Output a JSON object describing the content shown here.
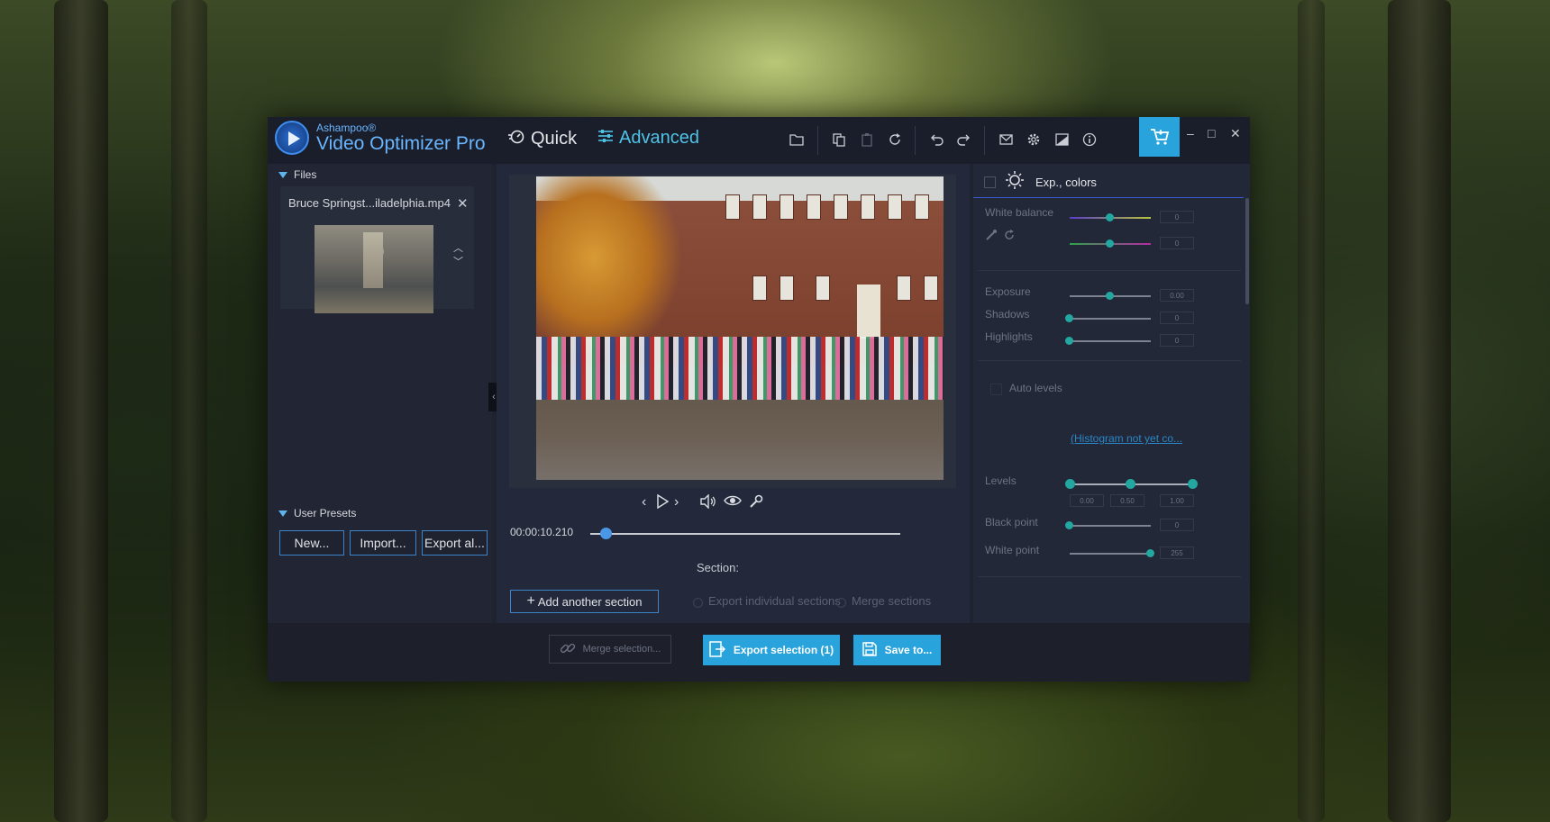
{
  "app": {
    "brand_small": "Ashampoo®",
    "brand_big": "Video Optimizer Pro",
    "mode_quick": "Quick",
    "mode_advanced": "Advanced",
    "accent_color": "#29a3dc",
    "toolbar_icons": [
      "folder-icon",
      "copy-icon",
      "paste-icon",
      "rotate-icon",
      "undo-icon",
      "redo-icon",
      "mail-icon",
      "settings-icon",
      "edit-icon",
      "info-icon",
      "cart-icon"
    ],
    "window_controls": {
      "minimize": "–",
      "maximize": "□",
      "close": "✕"
    }
  },
  "files": {
    "header": "Files",
    "items": [
      {
        "name": "Bruce Springst...iladelphia.mp4"
      }
    ]
  },
  "presets": {
    "header": "User Presets",
    "buttons": {
      "new": "New...",
      "import": "Import...",
      "export": "Export al..."
    }
  },
  "player": {
    "timecode": "00:00:10.210",
    "position_fraction": 0.05,
    "section_label": "Section:",
    "add_section": "Add another section",
    "export_individual": "Export individual sections",
    "merge_sections": "Merge sections"
  },
  "adjust": {
    "panel_title": "Exp., colors",
    "white_balance_label": "White balance",
    "white_balance_values": [
      "0",
      "0"
    ],
    "exposure_label": "Exposure",
    "exposure_value": "0.00",
    "shadows_label": "Shadows",
    "shadows_value": "0",
    "highlights_label": "Highlights",
    "highlights_value": "0",
    "auto_levels_label": "Auto levels",
    "histogram_link": "(Histogram not yet co...",
    "levels_label": "Levels",
    "levels_values": [
      "0.00",
      "0.50",
      "1.00"
    ],
    "black_point_label": "Black point",
    "black_point_value": "0",
    "white_point_label": "White point",
    "white_point_value": "255"
  },
  "footer": {
    "merge_selection": "Merge selection...",
    "export_selection": "Export selection (1)",
    "save_to": "Save to..."
  }
}
